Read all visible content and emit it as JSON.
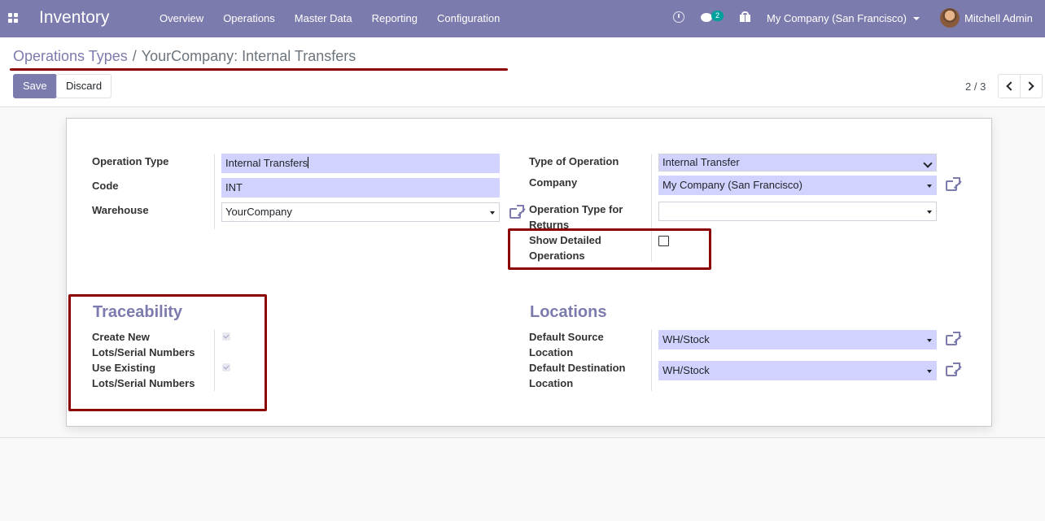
{
  "app": {
    "title": "Inventory"
  },
  "menu": [
    "Overview",
    "Operations",
    "Master Data",
    "Reporting",
    "Configuration"
  ],
  "systray": {
    "message_count": "2",
    "company": "My Company (San Francisco)",
    "user": "Mitchell Admin"
  },
  "breadcrumb": {
    "parent": "Operations Types",
    "separator": "/",
    "current": "YourCompany: Internal Transfers"
  },
  "buttons": {
    "save": "Save",
    "discard": "Discard"
  },
  "pager": {
    "value": "2 / 3"
  },
  "form": {
    "operation_type": {
      "label": "Operation Type",
      "value": "Internal Transfers"
    },
    "code": {
      "label": "Code",
      "value": "INT"
    },
    "warehouse": {
      "label": "Warehouse",
      "value": "YourCompany"
    },
    "type_of_operation": {
      "label": "Type of Operation",
      "value": "Internal Transfer"
    },
    "company": {
      "label": "Company",
      "value": "My Company (San Francisco)"
    },
    "return_type": {
      "label": "Operation Type for Returns",
      "value": ""
    },
    "show_detailed": {
      "label": "Show Detailed Operations",
      "checked": false
    },
    "traceability": {
      "title": "Traceability",
      "create_new": {
        "label": "Create New Lots/Serial Numbers",
        "checked": true
      },
      "use_existing": {
        "label": "Use Existing Lots/Serial Numbers",
        "checked": true
      }
    },
    "locations": {
      "title": "Locations",
      "default_src": {
        "label": "Default Source Location",
        "value": "WH/Stock"
      },
      "default_dest": {
        "label": "Default Destination Location",
        "value": "WH/Stock"
      }
    }
  },
  "colors": {
    "brand": "#7c7bad",
    "highlight": "#8b0000",
    "required": "#d2d2ff"
  }
}
